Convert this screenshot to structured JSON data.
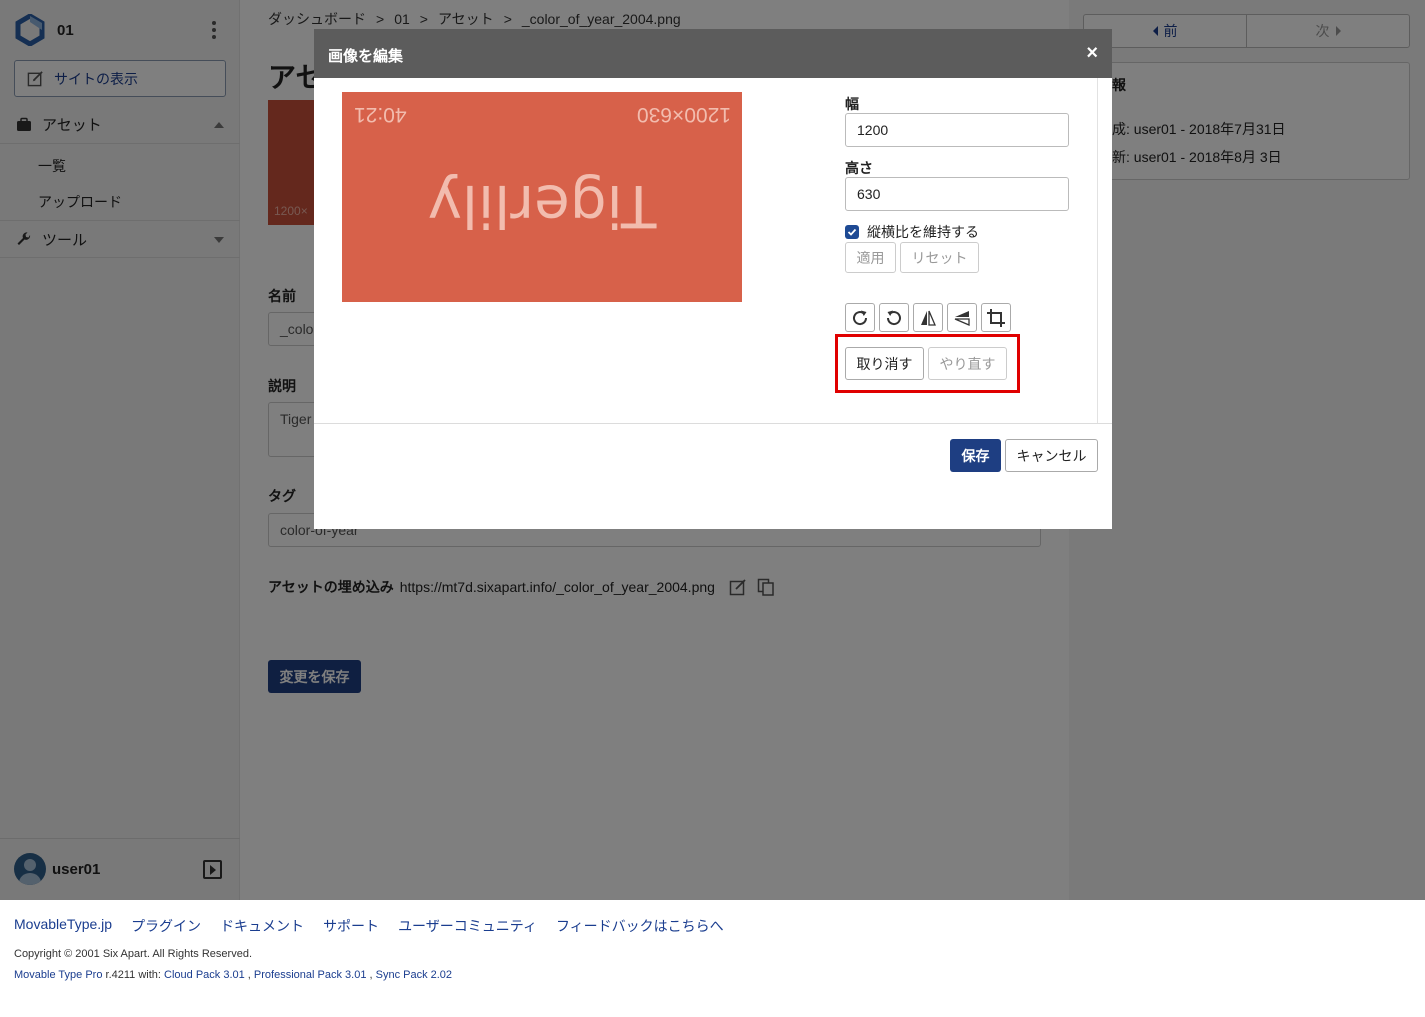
{
  "sidebar": {
    "site_name": "01",
    "view_site_label": "サイトの表示",
    "sections": [
      {
        "label": "アセット",
        "icon": "briefcase-icon",
        "expanded": true,
        "items": [
          "一覧",
          "アップロード"
        ]
      },
      {
        "label": "ツール",
        "icon": "wrench-icon",
        "expanded": false
      }
    ],
    "user_name": "user01"
  },
  "breadcrumb": [
    "ダッシュボード",
    "01",
    "アセット",
    "_color_of_year_2004.png"
  ],
  "breadcrumb_separator": ">",
  "page": {
    "title": "アセ",
    "thumb_caption": "1200×",
    "name_label": "名前",
    "name_value": "_colo",
    "description_label": "説明",
    "description_value": "Tiger",
    "tags_label": "タグ",
    "tags_value": "color-of-year",
    "embed_label": "アセットの埋め込み",
    "embed_url": "https://mt7d.sixapart.info/_color_of_year_2004.png",
    "save_changes_label": "変更を保存"
  },
  "rightcol": {
    "prev_label": "前",
    "next_label": "次",
    "info_title": "報",
    "created": "成: user01 - 2018年7月31日",
    "updated": "新: user01 - 2018年8月 3日"
  },
  "footer": {
    "links": [
      "MovableType.jp",
      "プラグイン",
      "ドキュメント",
      "サポート",
      "ユーザーコミュニティ",
      "フィードバックはこちらへ"
    ],
    "copyright": "Copyright © 2001 Six Apart. All Rights Reserved.",
    "version_product": "Movable Type Pro",
    "version_rest": " r.4211 with: ",
    "packs": [
      "Cloud Pack 3.01",
      "Professional Pack 3.01",
      "Sync Pack 2.02"
    ],
    "pack_separator": " , "
  },
  "modal": {
    "title": "画像を編集",
    "close_glyph": "×",
    "preview": {
      "size_text": "1200×630",
      "ratio_text": "40:21",
      "name_text": "Tigerlily",
      "background": "#d7614a",
      "rotation_degrees": 180
    },
    "width_label": "幅",
    "width_value": "1200",
    "height_label": "高さ",
    "height_value": "630",
    "keep_ratio_label": "縦横比を維持する",
    "keep_ratio_checked": true,
    "apply_label": "適用",
    "reset_label": "リセット",
    "tools": [
      "rotate-right-icon",
      "rotate-left-icon",
      "flip-horizontal-icon",
      "flip-vertical-icon",
      "crop-icon"
    ],
    "undo_label": "取り消す",
    "redo_label": "やり直す",
    "save_label": "保存",
    "cancel_label": "キャンセル"
  },
  "colors": {
    "accent": "#1e3e82",
    "highlight": "#e00000",
    "modal_header": "#5c5c5c"
  }
}
